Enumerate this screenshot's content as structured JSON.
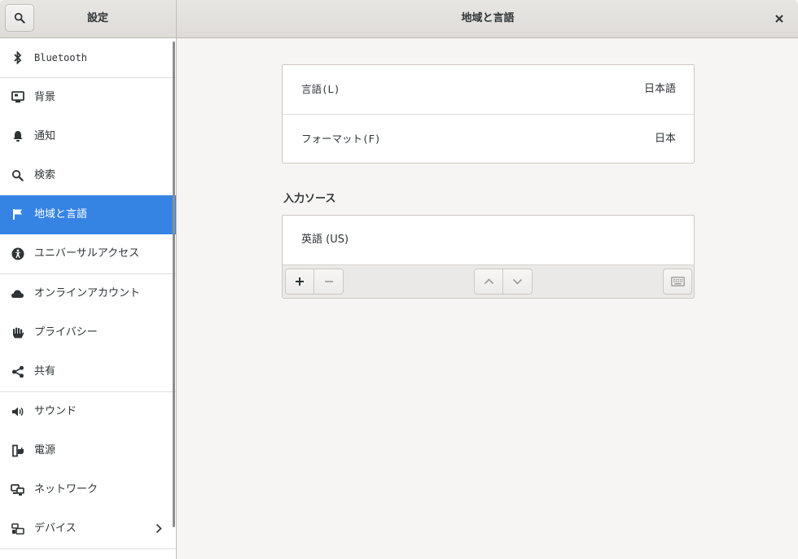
{
  "header": {
    "sidebar_title": "設定",
    "main_title": "地域と言語"
  },
  "sidebar": {
    "items": [
      {
        "label": "Bluetooth",
        "icon": "bluetooth-icon"
      },
      {
        "label": "背景",
        "icon": "background-icon"
      },
      {
        "label": "通知",
        "icon": "bell-icon"
      },
      {
        "label": "検索",
        "icon": "search-icon"
      },
      {
        "label": "地域と言語",
        "icon": "flag-icon",
        "active": true
      },
      {
        "label": "ユニバーサルアクセス",
        "icon": "accessibility-icon"
      },
      {
        "label": "オンラインアカウント",
        "icon": "cloud-icon"
      },
      {
        "label": "プライバシー",
        "icon": "hand-icon"
      },
      {
        "label": "共有",
        "icon": "share-icon"
      },
      {
        "label": "サウンド",
        "icon": "speaker-icon"
      },
      {
        "label": "電源",
        "icon": "power-plug-icon"
      },
      {
        "label": "ネットワーク",
        "icon": "network-icon"
      },
      {
        "label": "デバイス",
        "icon": "devices-icon"
      }
    ]
  },
  "settings": {
    "language_label": "言語(L)",
    "language_value": "日本語",
    "format_label": "フォーマット(F)",
    "format_value": "日本"
  },
  "input_sources": {
    "heading": "入力ソース",
    "items": [
      "英語 (US)"
    ]
  },
  "colors": {
    "accent": "#3584e4",
    "background": "#f6f5f4"
  }
}
